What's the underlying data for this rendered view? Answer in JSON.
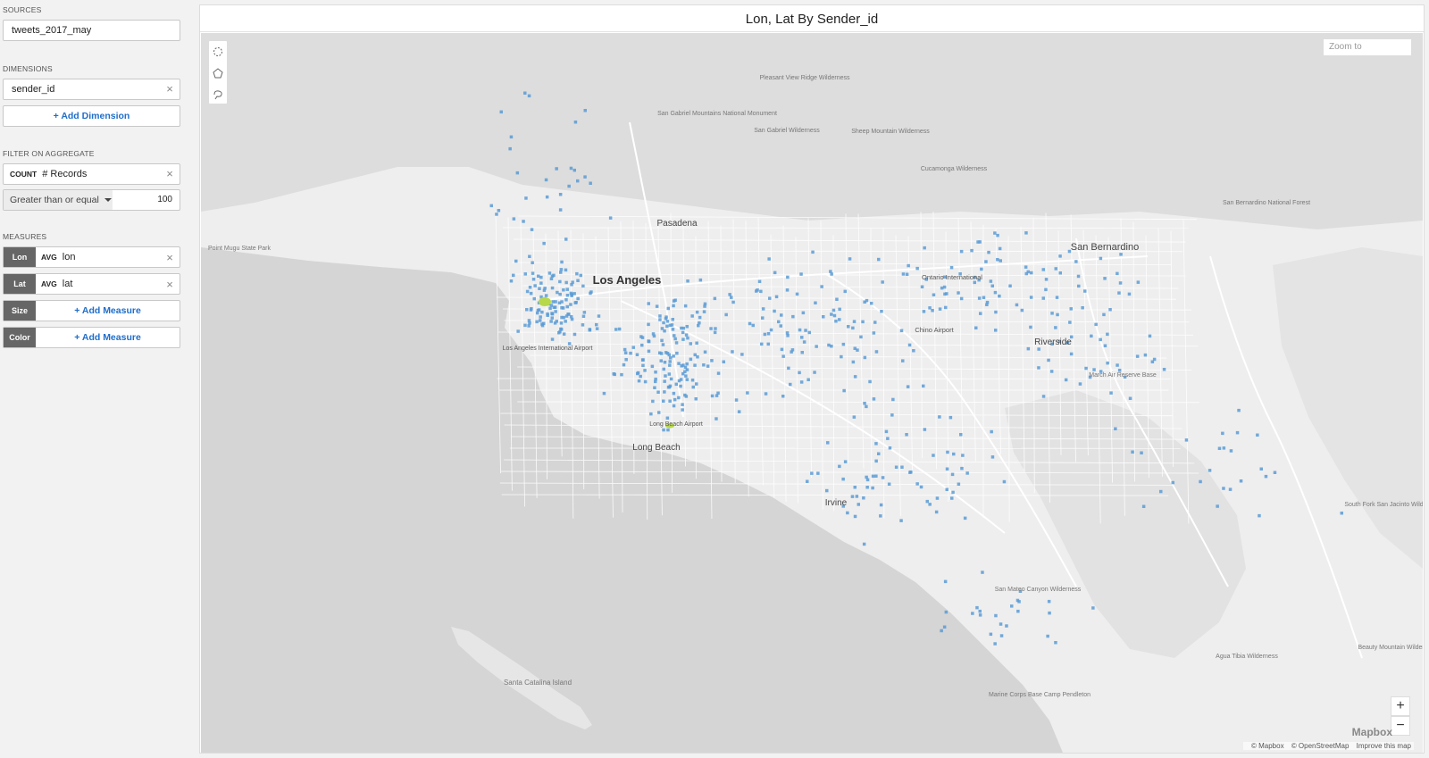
{
  "sidebar": {
    "sources_label": "SOURCES",
    "source_value": "tweets_2017_may",
    "dimensions_label": "DIMENSIONS",
    "dimension_value": "sender_id",
    "add_dimension": "+ Add Dimension",
    "filter_label": "FILTER ON AGGREGATE",
    "filter_agg": "COUNT",
    "filter_field": "# Records",
    "filter_operator": "Greater than or equal",
    "filter_value": "100",
    "measures_label": "MEASURES",
    "measures": [
      {
        "tag": "Lon",
        "agg": "AVG",
        "field": "lon"
      },
      {
        "tag": "Lat",
        "agg": "AVG",
        "field": "lat"
      },
      {
        "tag": "Size",
        "add": "+ Add Measure"
      },
      {
        "tag": "Color",
        "add": "+ Add Measure"
      }
    ]
  },
  "chart": {
    "title": "Lon,  Lat By Sender_id",
    "zoom_placeholder": "Zoom to",
    "zoom_in": "+",
    "zoom_out": "−",
    "attribution": [
      "© Mapbox",
      "© OpenStreetMap",
      "Improve this map"
    ],
    "logo": "Mapbox",
    "place_labels": [
      {
        "name": "Los Angeles",
        "major": true
      },
      {
        "name": "Pasadena"
      },
      {
        "name": "Long Beach"
      },
      {
        "name": "Irvine"
      },
      {
        "name": "San Bernardino"
      },
      {
        "name": "Riverside"
      },
      {
        "name": "Ontario International"
      },
      {
        "name": "Chino Airport"
      },
      {
        "name": "Los Angeles International Airport"
      },
      {
        "name": "Long Beach Airport"
      },
      {
        "name": "Santa Catalina Island"
      },
      {
        "name": "Point Mugu State Park"
      },
      {
        "name": "San Gabriel Mountains National Monument"
      },
      {
        "name": "San Gabriel Wilderness"
      },
      {
        "name": "Pleasant View Ridge Wilderness"
      },
      {
        "name": "Sheep Mountain Wilderness"
      },
      {
        "name": "Cucamonga Wilderness"
      },
      {
        "name": "San Bernardino National Forest"
      },
      {
        "name": "March Air Reserve Base"
      },
      {
        "name": "San Mateo Canyon Wilderness"
      },
      {
        "name": "South Fork San Jacinto Wilderness"
      },
      {
        "name": "Agua Tibia Wilderness"
      },
      {
        "name": "Beauty Mountain Wilderness"
      },
      {
        "name": "Marine Corps Base Camp Pendleton"
      }
    ]
  },
  "colors": {
    "point": "#5b9bd5",
    "hotspot": "#b7d84a",
    "water": "#d3d3d3",
    "land": "#f1f1f1"
  }
}
